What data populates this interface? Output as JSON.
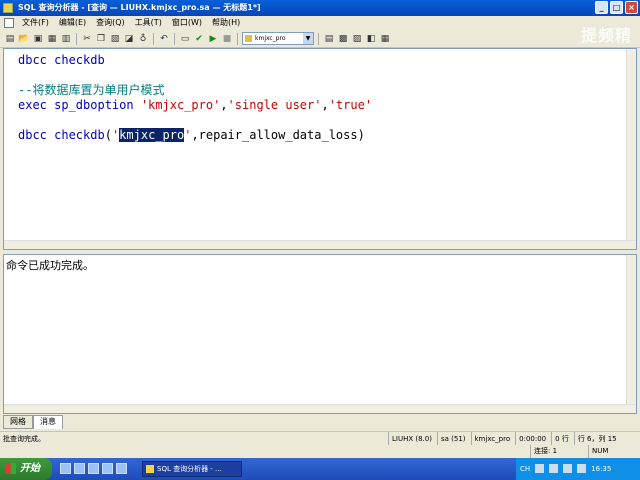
{
  "window": {
    "title": "SQL 查询分析器 - [查询 — LIUHX.kmjxc_pro.sa — 无标题1*]",
    "controls": [
      "_",
      "□",
      "×"
    ]
  },
  "menubar": {
    "items": [
      "文件(F)",
      "编辑(E)",
      "查询(Q)",
      "工具(T)",
      "窗口(W)",
      "帮助(H)"
    ]
  },
  "toolbar": {
    "database": "kmjxc_pro",
    "icons": [
      "new-query-icon",
      "open-icon",
      "save-icon",
      "insert-template-icon",
      "load-script-icon",
      "cut-icon",
      "copy-icon",
      "paste-icon",
      "clear-icon",
      "find-icon",
      "undo-icon",
      "execute-mode-icon",
      "parse-icon",
      "execute-icon",
      "stop-icon",
      "object-browser-icon",
      "object-search-icon",
      "show-plan-icon",
      "options-icon",
      "results-pane-icon"
    ]
  },
  "watermark": "提频精",
  "editor": {
    "lines": [
      {
        "parts": [
          {
            "t": "dbcc checkdb",
            "c": "kw"
          }
        ]
      },
      {
        "parts": []
      },
      {
        "parts": [
          {
            "t": "--将数据库置为单用户模式",
            "c": "cmt"
          }
        ]
      },
      {
        "parts": [
          {
            "t": "exec sp_dboption ",
            "c": "kw"
          },
          {
            "t": "'kmjxc_pro'",
            "c": "str"
          },
          {
            "t": ",",
            "c": ""
          },
          {
            "t": "'single user'",
            "c": "str"
          },
          {
            "t": ",",
            "c": ""
          },
          {
            "t": "'true'",
            "c": "str"
          }
        ]
      },
      {
        "parts": []
      },
      {
        "parts": [
          {
            "t": "dbcc checkdb",
            "c": "kw"
          },
          {
            "t": "(",
            "c": ""
          },
          {
            "t": "'",
            "c": "str"
          },
          {
            "t": "kmjxc_pro",
            "c": "sel"
          },
          {
            "t": "'",
            "c": "str"
          },
          {
            "t": ",repair_allow_data_loss)",
            "c": ""
          }
        ]
      }
    ]
  },
  "results": {
    "message": "命令已成功完成。"
  },
  "tabs": [
    "网格",
    "消息"
  ],
  "status": {
    "left": "批查询完成。",
    "server": "LIUHX (8.0)",
    "user": "sa (51)",
    "db": "kmjxc_pro",
    "time": "0:00:00",
    "rows": "0 行",
    "position": "行 6，列 15",
    "connections": "连接: 1",
    "mode": "NUM"
  },
  "taskbar": {
    "start": "开始",
    "app": "SQL 查询分析器 - ...",
    "lang": "CH",
    "clock": "16:35"
  }
}
